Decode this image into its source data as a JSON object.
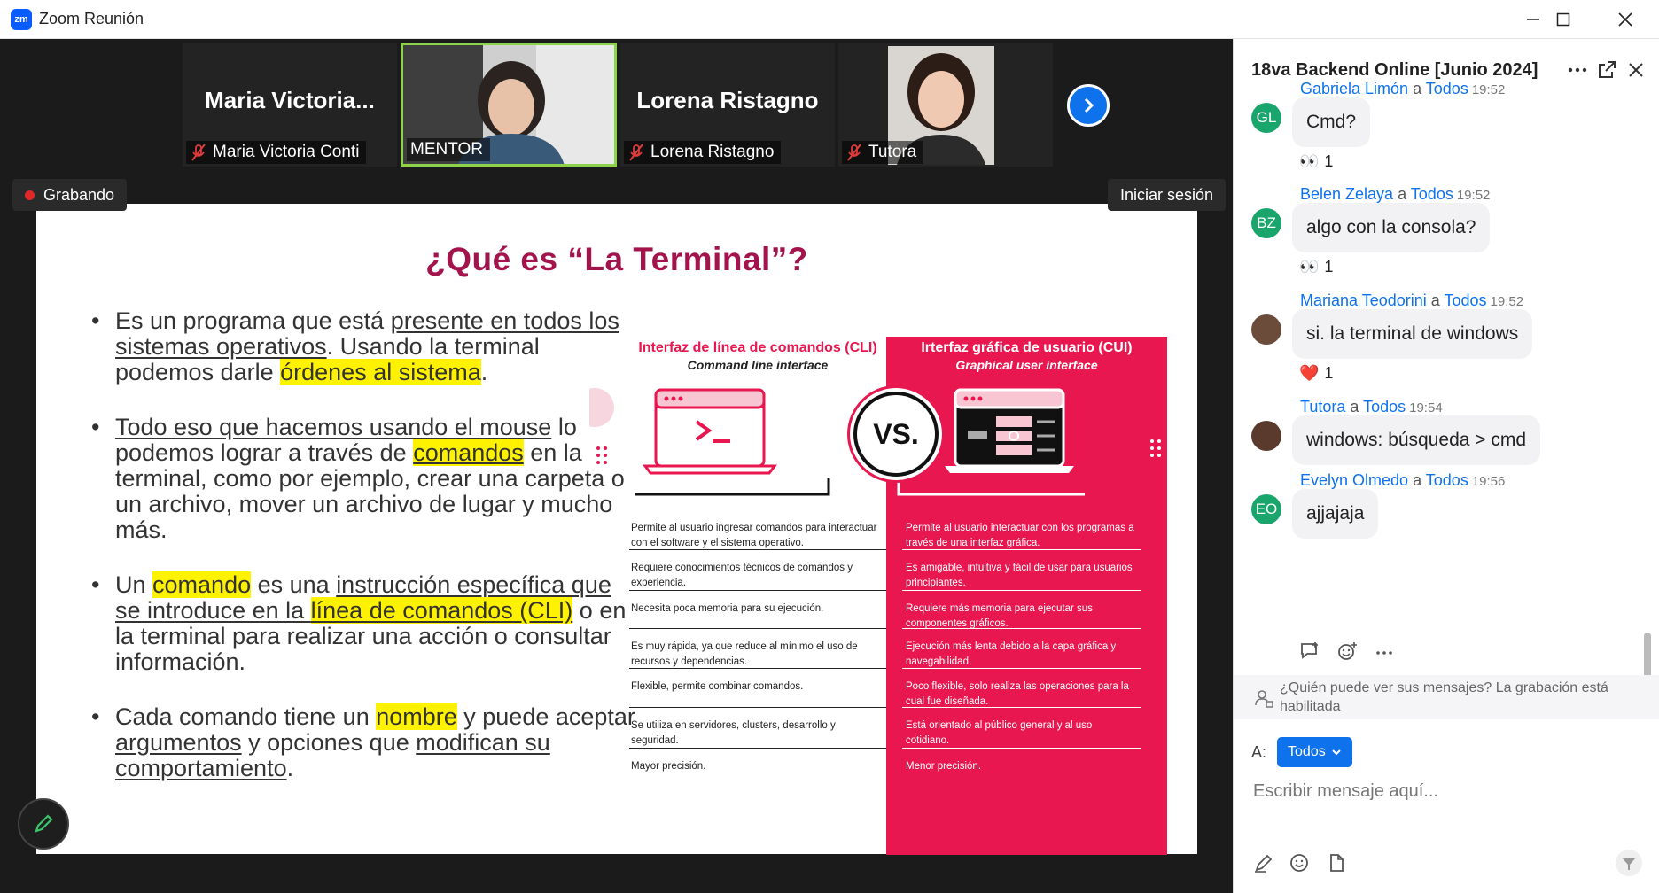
{
  "window": {
    "title": "Zoom Reunión",
    "logo_text": "zm"
  },
  "participants": [
    {
      "display": "Maria  Victoria...",
      "caption": "Maria Victoria Conti",
      "muted": true,
      "video": false
    },
    {
      "display": "",
      "caption": "MENTOR",
      "muted": false,
      "video": true,
      "active": true
    },
    {
      "display": "Lorena Ristagno",
      "caption": "Lorena Ristagno",
      "muted": true,
      "video": false
    },
    {
      "display": "",
      "caption": "Tutora",
      "muted": true,
      "video": true
    }
  ],
  "overlay": {
    "recording": "Grabando",
    "login": "Iniciar sesión"
  },
  "slide": {
    "title": "¿Qué es “La Terminal”?",
    "bullet1": {
      "a": "Es un programa que está ",
      "u1": "presente en todos los sistemas operativos",
      "b": ". Usando la terminal podemos darle ",
      "h1": "órdenes al sistema",
      "c": "."
    },
    "bullet2": {
      "u1": "Todo eso que hacemos usando el mouse",
      "a": " lo podemos lograr a través de ",
      "h1": "comandos",
      "b": " en la terminal, como por ejemplo, crear una carpeta o un archivo, mover un archivo de lugar y mucho más."
    },
    "bullet3": {
      "a": "Un ",
      "h1": "comando",
      "b": " es una ",
      "u1": "instrucción específica que se introduce en la ",
      "h2": "línea de comandos (CLI)",
      "c": " o en la terminal para realizar una acción o consultar información."
    },
    "bullet4": {
      "a": "Cada comando tiene un ",
      "h1": "nombre",
      "b": " y puede aceptar ",
      "u1": "argumentos",
      "c": " y opciones que ",
      "u2": "modifican su comportamiento",
      "d": "."
    },
    "infographic": {
      "cli_title": "Interfaz de línea de comandos (CLI)",
      "cli_subtitle": "Command line interface",
      "gui_title": "Irterfaz gráfica de usuario (CUI)",
      "gui_subtitle": "Graphical user interface",
      "vs": "VS.",
      "cli_rows": [
        "Permite al usuario ingresar comandos para interactuar con el software y el sistema operativo.",
        "Requiere conocimientos técnicos de comandos y experiencia.",
        "Necesita poca memoria para su ejecución.",
        "Es muy rápida, ya que reduce al mínimo el uso de recursos y dependencias.",
        "Flexible, permite combinar comandos.",
        "Se utiliza en servidores, clusters, desarrollo y seguridad.",
        "Mayor precisión."
      ],
      "gui_rows": [
        "Permite al usuario interactuar con los programas a través de una interfaz gráfica.",
        "Es amigable, intuitiva y fácil de usar para usuarios principiantes.",
        "Requiere más memoria para ejecutar sus componentes gráficos.",
        "Ejecución más lenta debido a la capa gráfica y navegabilidad.",
        "Poco flexible, solo realiza las operaciones para la cual fue diseñada.",
        "Está orientado al público general y al uso cotidiano.",
        "Menor precisión."
      ]
    }
  },
  "chat": {
    "title": "18va Backend Online [Junio 2024]",
    "messages": [
      {
        "initials": "GL",
        "avatar_color": "#1aa56d",
        "sender": "Gabriela Limón",
        "to": "a",
        "target": "Todos",
        "time": "19:52",
        "text": "Cmd?",
        "reaction": "👀",
        "count": "1"
      },
      {
        "initials": "BZ",
        "avatar_color": "#1aa56d",
        "sender": "Belen Zelaya",
        "to": "a",
        "target": "Todos",
        "time": "19:52",
        "text": "algo con la consola?",
        "reaction": "👀",
        "count": "1"
      },
      {
        "initials": "",
        "avatar_color": "#6b4b3a",
        "sender": "Mariana Teodorini",
        "to": "a",
        "target": "Todos",
        "time": "19:52",
        "text": "si. la terminal de windows",
        "reaction": "❤️",
        "count": "1"
      },
      {
        "initials": "",
        "avatar_color": "#5b3a2e",
        "sender": "Tutora",
        "to": "a",
        "target": "Todos",
        "time": "19:54",
        "text": "windows: búsqueda > cmd",
        "reaction": "",
        "count": ""
      },
      {
        "initials": "EO",
        "avatar_color": "#1aa56d",
        "sender": "Evelyn Olmedo",
        "to": "a",
        "target": "Todos",
        "time": "19:56",
        "text": "ajjajaja",
        "reaction": "",
        "count": ""
      }
    ],
    "privacy_notice": "¿Quién puede ver sus mensajes? La grabación está habilitada",
    "to_label": "A:",
    "to_value": "Todos",
    "placeholder": "Escribir mensaje aquí..."
  }
}
